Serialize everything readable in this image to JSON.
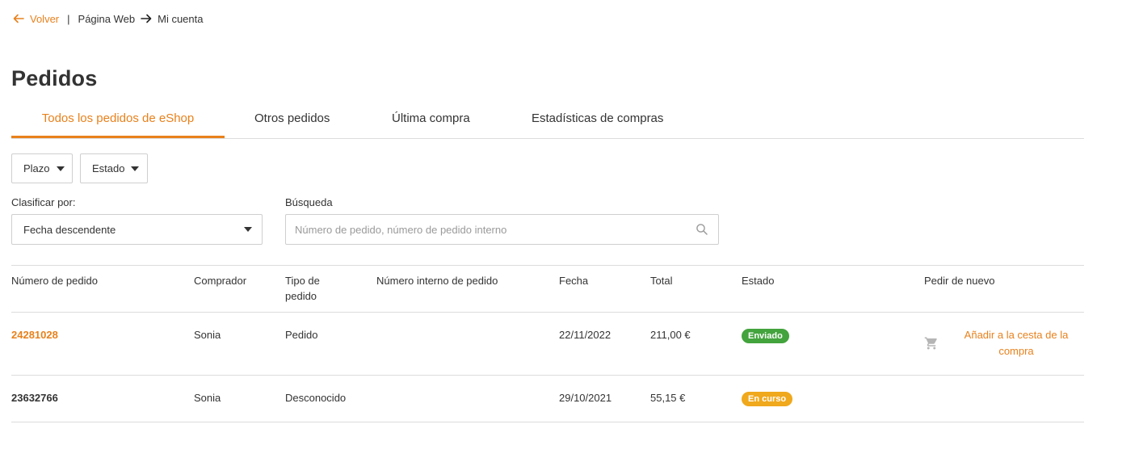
{
  "breadcrumb": {
    "back_label": "Volver",
    "separator": "|",
    "items": [
      "Página Web",
      "Mi cuenta"
    ]
  },
  "page": {
    "title": "Pedidos"
  },
  "tabs": [
    {
      "label": "Todos los pedidos de eShop",
      "active": true
    },
    {
      "label": "Otros pedidos",
      "active": false
    },
    {
      "label": "Última compra",
      "active": false
    },
    {
      "label": "Estadísticas de compras",
      "active": false
    }
  ],
  "filters": {
    "period_label": "Plazo",
    "status_label": "Estado"
  },
  "sort": {
    "label": "Clasificar por:",
    "selected": "Fecha descendente"
  },
  "search": {
    "label": "Búsqueda",
    "placeholder": "Número de pedido, número de pedido interno",
    "value": ""
  },
  "table": {
    "headers": {
      "order_number": "Número de pedido",
      "buyer": "Comprador",
      "order_type": "Tipo de pedido",
      "internal_number": "Número interno de pedido",
      "date": "Fecha",
      "total": "Total",
      "status": "Estado",
      "reorder": "Pedir de nuevo"
    },
    "rows": [
      {
        "order_number": "24281028",
        "buyer": "Sonia",
        "order_type": "Pedido",
        "internal_number": "",
        "date": "22/11/2022",
        "total": "211,00 €",
        "status": "Enviado",
        "reorder_label": "Añadir a la cesta de la compra"
      },
      {
        "order_number": "23632766",
        "buyer": "Sonia",
        "order_type": "Desconocido",
        "internal_number": "",
        "date": "29/10/2021",
        "total": "55,15 €",
        "status": "En curso"
      }
    ]
  },
  "colors": {
    "accent": "#e8811c",
    "status_sent": "#43a33d",
    "status_in_progress": "#f0a81c",
    "border": "#dcdcdc",
    "text": "#333333"
  },
  "icons": {
    "back": "arrow-left-icon",
    "breadcrumb_separator": "arrow-right-icon",
    "search": "search-icon",
    "cart": "cart-icon",
    "dropdown": "caret-down-icon"
  }
}
